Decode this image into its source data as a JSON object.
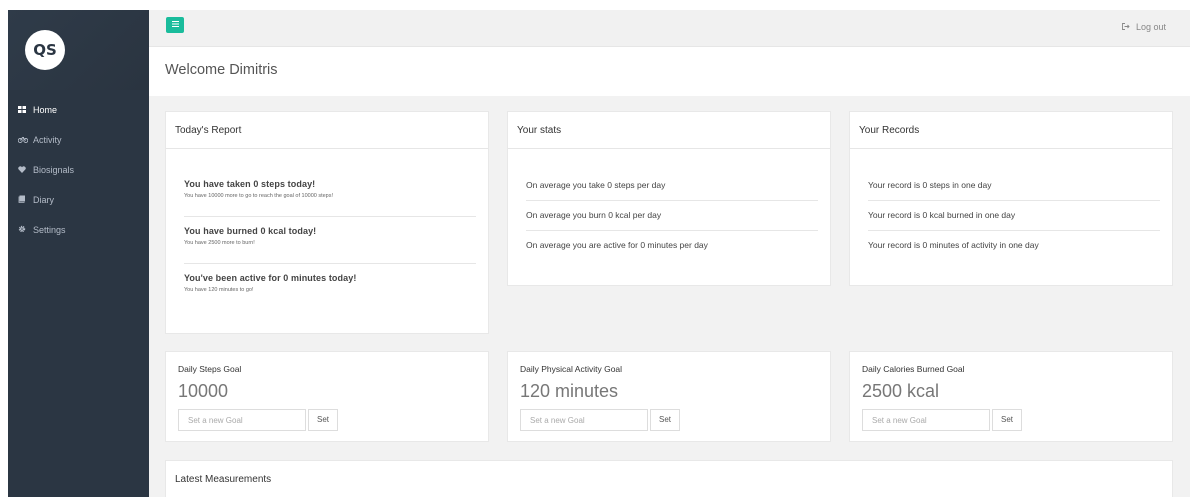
{
  "sidebar": {
    "logo": "QS",
    "items": [
      {
        "label": "Home",
        "icon": "grid-icon"
      },
      {
        "label": "Activity",
        "icon": "bike-icon"
      },
      {
        "label": "Biosignals",
        "icon": "heart-icon"
      },
      {
        "label": "Diary",
        "icon": "book-icon"
      },
      {
        "label": "Settings",
        "icon": "gear-icon"
      }
    ]
  },
  "topbar": {
    "menu_icon": "hamburger-icon",
    "logout_label": "Log out"
  },
  "welcome": {
    "title": "Welcome Dimitris"
  },
  "report": {
    "title": "Today's Report",
    "items": [
      {
        "title": "You have taken 0 steps today!",
        "sub": "You have 10000 more to go to reach the goal of 10000 steps!"
      },
      {
        "title": "You have burned 0 kcal today!",
        "sub": "You have 2500 more to burn!"
      },
      {
        "title": "You've been active for 0 minutes today!",
        "sub": "You have 120 minutes to go!"
      }
    ]
  },
  "stats": {
    "title": "Your stats",
    "lines": [
      "On average you take 0 steps per day",
      "On average you burn 0 kcal per day",
      "On average you are active for 0 minutes per day"
    ]
  },
  "records": {
    "title": "Your Records",
    "lines": [
      "Your record is 0 steps in one day",
      "Your record is 0 kcal burned in one day",
      "Your record is 0 minutes of activity in one day"
    ]
  },
  "goals": [
    {
      "label": "Daily Steps Goal",
      "value": "10000",
      "placeholder": "Set a new Goal",
      "button": "Set"
    },
    {
      "label": "Daily Physical Activity Goal",
      "value": "120 minutes",
      "placeholder": "Set a new Goal",
      "button": "Set"
    },
    {
      "label": "Daily Calories Burned Goal",
      "value": "2500 kcal",
      "placeholder": "Set a new Goal",
      "button": "Set"
    }
  ],
  "measurements": {
    "title": "Latest Measurements"
  },
  "colors": {
    "sidebar": "#2b3643",
    "accent": "#1abc9c",
    "content_bg": "#f2f2f2"
  }
}
